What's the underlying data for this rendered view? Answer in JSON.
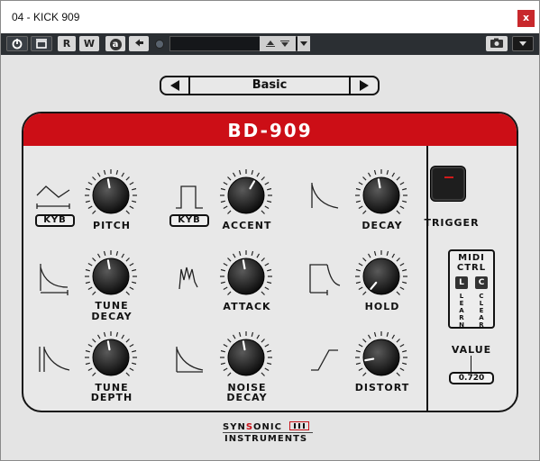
{
  "window": {
    "title": "04 - KICK 909",
    "close_glyph": "x"
  },
  "toolbar": {
    "power_icon": "power-icon",
    "bypass_icon": "bypass-icon",
    "read_label": "R",
    "write_label": "W",
    "automation_label": "a",
    "back_icon": "arrow-left-icon",
    "camera_icon": "camera-icon",
    "dropdown_icon": "chevron-down-icon"
  },
  "preset": {
    "name": "Basic"
  },
  "instrument": {
    "title": "BD-909",
    "params": [
      {
        "label_line1": "PITCH",
        "label_line2": "",
        "kyb": "KYB",
        "icon": "lfo-triangle-icon"
      },
      {
        "label_line1": "ACCENT",
        "label_line2": "",
        "kyb": "KYB",
        "icon": "square-pulse-icon"
      },
      {
        "label_line1": "DECAY",
        "label_line2": "",
        "kyb": "",
        "icon": "decay-curve-icon"
      },
      {
        "label_line1": "TUNE",
        "label_line2": "DECAY",
        "kyb": "",
        "icon": "tune-decay-icon"
      },
      {
        "label_line1": "ATTACK",
        "label_line2": "",
        "kyb": "",
        "icon": "attack-wave-icon"
      },
      {
        "label_line1": "HOLD",
        "label_line2": "",
        "kyb": "",
        "icon": "hold-envelope-icon"
      },
      {
        "label_line1": "TUNE",
        "label_line2": "DEPTH",
        "kyb": "",
        "icon": "tune-depth-icon"
      },
      {
        "label_line1": "NOISE",
        "label_line2": "DECAY",
        "kyb": "",
        "icon": "noise-decay-icon"
      },
      {
        "label_line1": "DISTORT",
        "label_line2": "",
        "kyb": "",
        "icon": "distort-curve-icon"
      }
    ],
    "trigger_label": "TRIGGER",
    "midi": {
      "line1": "MIDI",
      "line2": "CTRL",
      "learn_btn": "L",
      "clear_btn": "C",
      "learn_text": "LEARN",
      "clear_text": "CLEAR"
    },
    "value_label": "VALUE",
    "value": "0.720"
  },
  "brand": {
    "line1": "SYNSONIC",
    "line2": "INSTRUMENTS"
  },
  "colors": {
    "header_red": "#cc0e16",
    "toolbar_dark": "#2b2f33",
    "panel": "#e4e4e4"
  }
}
